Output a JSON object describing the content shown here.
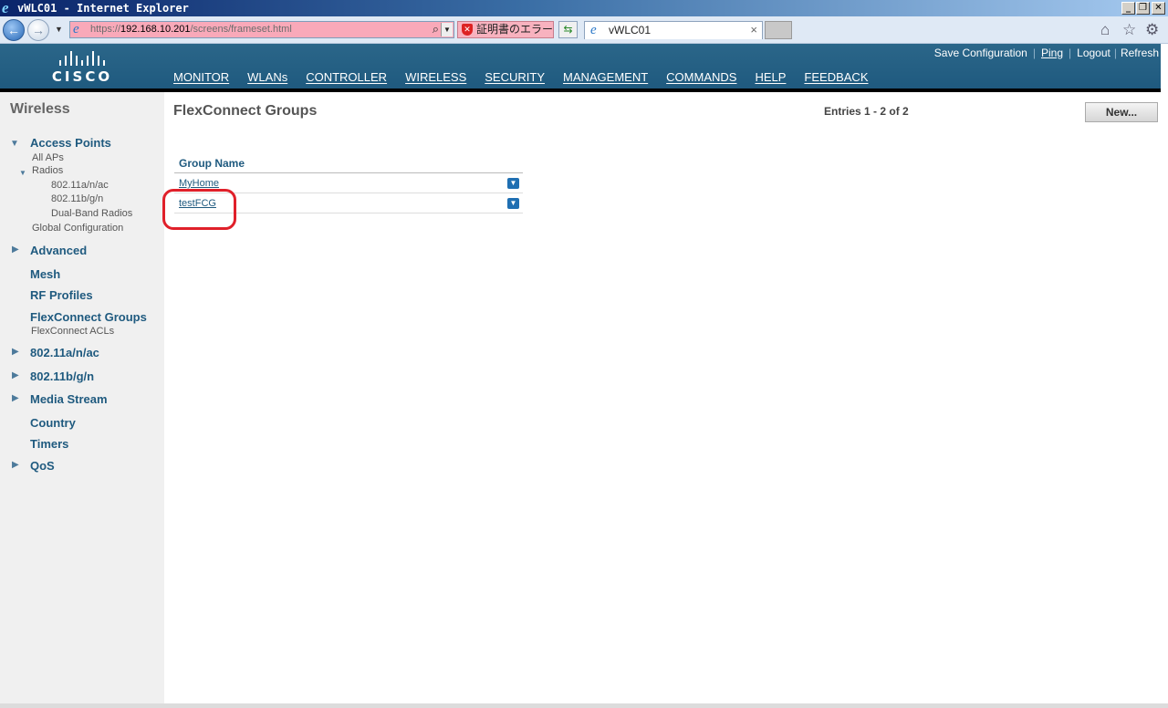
{
  "window": {
    "title": "vWLC01 - Internet Explorer",
    "minimize": "_",
    "restore": "❐",
    "close": "✕"
  },
  "browser": {
    "url_prefix": "https://",
    "url_host": "192.168.10.201",
    "url_path": "/screens/frameset.html",
    "cert_error": "証明書のエラー",
    "tab_title": "vWLC01",
    "tab_close": "×",
    "icons": [
      "back-icon",
      "forward-icon",
      "search-icon",
      "home-icon",
      "star-icon",
      "gear-icon"
    ]
  },
  "brand": {
    "logo_text": "CISCO"
  },
  "toplinks": [
    "Save Configuration",
    "Ping",
    "Logout",
    "Refresh"
  ],
  "nav": {
    "items": [
      "MONITOR",
      "WLANs",
      "CONTROLLER",
      "WIRELESS",
      "SECURITY",
      "MANAGEMENT",
      "COMMANDS",
      "HELP",
      "FEEDBACK"
    ],
    "active": "WIRELESS",
    "active_color": "#f39c12"
  },
  "sidebar": {
    "heading": "Wireless",
    "access_points": "Access Points",
    "all_aps": "All APs",
    "radios": "Radios",
    "radio_a": "802.11a/n/ac",
    "radio_b": "802.11b/g/n",
    "dual_band": "Dual-Band Radios",
    "global_config": "Global Configuration",
    "advanced": "Advanced",
    "mesh": "Mesh",
    "rf_profiles": "RF Profiles",
    "flex_groups": "FlexConnect Groups",
    "flex_acls": "FlexConnect ACLs",
    "s80211a": "802.11a/n/ac",
    "s80211b": "802.11b/g/n",
    "media_stream": "Media Stream",
    "country": "Country",
    "timers": "Timers",
    "qos": "QoS"
  },
  "main": {
    "title": "FlexConnect Groups",
    "entries": "Entries 1 - 2 of 2",
    "new_button": "New...",
    "table": {
      "header": "Group Name",
      "rows": [
        "MyHome",
        "testFCG"
      ]
    }
  },
  "colors": {
    "header_bg": "#1f5a7f",
    "highlight": "#e0202a"
  }
}
